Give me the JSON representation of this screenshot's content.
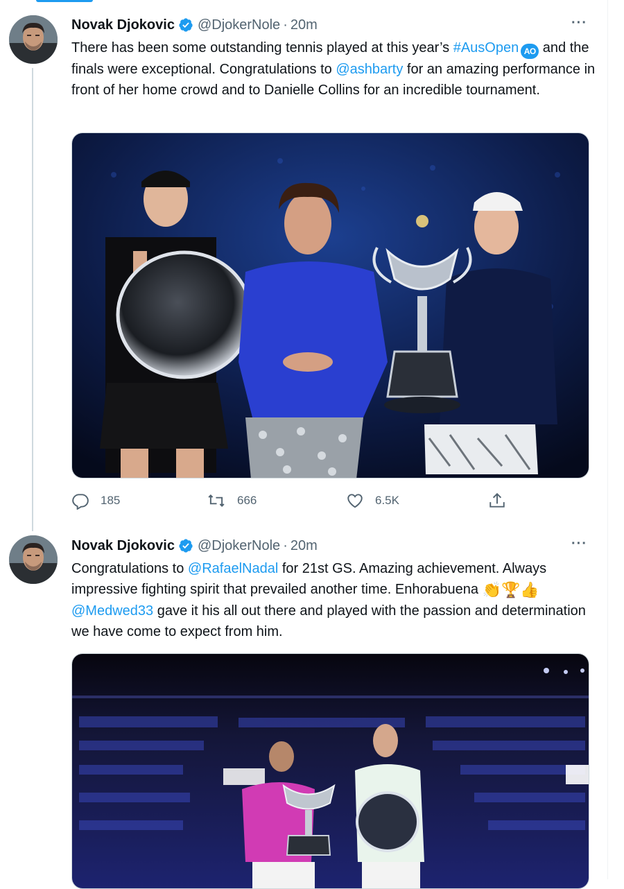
{
  "tweets": [
    {
      "author_name": "Novak Djokovic",
      "handle": "@DjokerNole",
      "time": "20m",
      "text": [
        {
          "t": "There has been some outstanding tennis played at this year’s "
        },
        {
          "t": "#AusOpen",
          "link": true
        },
        {
          "badge": "AO"
        },
        {
          "t": " and the finals were exceptional. Congratulations to "
        },
        {
          "t": "@ashbarty",
          "link": true
        },
        {
          "t": " for an amazing performance in front of her home crowd and to Danielle Collins for an incredible tournament."
        }
      ],
      "media_label": "Women's final trophy ceremony photo",
      "stats": {
        "replies": "185",
        "retweets": "666",
        "likes": "6.5K"
      }
    },
    {
      "author_name": "Novak Djokovic",
      "handle": "@DjokerNole",
      "time": "20m",
      "text": [
        {
          "t": "Congratulations to "
        },
        {
          "t": "@RafaelNadal",
          "link": true
        },
        {
          "t": " for 21st GS. Amazing achievement. Always impressive fighting spirit that prevailed another time. Enhorabuena "
        },
        {
          "emoji": "👏🏆👍"
        },
        {
          "t": "  "
        },
        {
          "t": "@Medwed33",
          "link": true
        },
        {
          "t": " gave it his all out there and played with the passion and determination we have come to expect from him."
        }
      ],
      "media_label": "Men's final trophy ceremony photo"
    }
  ],
  "ui": {
    "more_label": "···"
  },
  "colors": {
    "accent": "#1d9bf0",
    "text": "#0f1419",
    "muted": "#536471"
  },
  "icons": [
    "verified-badge-icon",
    "more-icon",
    "reply-icon",
    "retweet-icon",
    "like-icon",
    "share-icon"
  ]
}
